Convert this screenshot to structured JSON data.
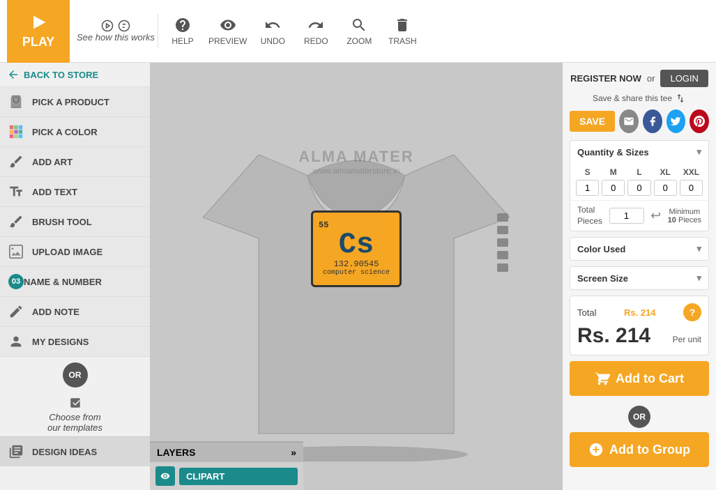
{
  "topbar": {
    "play_label": "PLAY",
    "how_it_works": "See how this works",
    "tools": [
      {
        "id": "help",
        "label": "HELP",
        "icon": "question-circle"
      },
      {
        "id": "preview",
        "label": "PREVIEW",
        "icon": "eye"
      },
      {
        "id": "undo",
        "label": "UNDO",
        "icon": "undo"
      },
      {
        "id": "redo",
        "label": "REDO",
        "icon": "redo"
      },
      {
        "id": "zoom",
        "label": "ZOOM",
        "icon": "search"
      },
      {
        "id": "trash",
        "label": "TRASH",
        "icon": "trash"
      }
    ]
  },
  "sidebar": {
    "back_label": "BACK TO STORE",
    "items": [
      {
        "id": "pick-product",
        "label": "PICK A PRODUCT",
        "icon": "tshirt"
      },
      {
        "id": "pick-color",
        "label": "PICK A COLOR",
        "icon": "grid"
      },
      {
        "id": "add-art",
        "label": "ADD ART",
        "icon": "brush"
      },
      {
        "id": "add-text",
        "label": "ADD TEXT",
        "icon": "T"
      },
      {
        "id": "brush-tool",
        "label": "BRUSH TOOL",
        "icon": "pencil"
      },
      {
        "id": "upload-image",
        "label": "UPLOAD IMAGE",
        "icon": "image"
      },
      {
        "id": "name-number",
        "label": "NAME & NUMBER",
        "icon": "03"
      },
      {
        "id": "add-note",
        "label": "ADD NOTE",
        "icon": "pencil2"
      },
      {
        "id": "my-designs",
        "label": "MY DESIGNS",
        "icon": "person"
      }
    ],
    "or_label": "OR",
    "choose_templates": "Choose from\nour templates",
    "design_ideas": "DESIGN IDEAS"
  },
  "canvas": {
    "watermark_brand": "ALMA MATER",
    "watermark_url": "www.almamaterstore.in",
    "clipart": {
      "number": "55",
      "symbol": "Cs",
      "mass": "132.90545",
      "name": "computer science"
    }
  },
  "layers": {
    "header": "LAYERS",
    "items": [
      {
        "id": "clipart",
        "label": "CLIPART",
        "visible": true
      }
    ]
  },
  "right_panel": {
    "register_label": "REGISTER NOW",
    "or_label": "or",
    "login_label": "LOGIN",
    "save_share_label": "Save & share this tee",
    "save_btn": "SAVE",
    "quantity_sizes": {
      "title": "Quantity & Sizes",
      "sizes": [
        "S",
        "M",
        "L",
        "XL",
        "XXL"
      ],
      "values": [
        "1",
        "0",
        "0",
        "0",
        "0"
      ],
      "total_label": "Total\nPieces",
      "total_value": "1",
      "min_label": "Minimum",
      "min_value": "10",
      "min_pieces": "Pieces"
    },
    "color_used": {
      "title": "Color Used"
    },
    "screen_size": {
      "title": "Screen Size"
    },
    "total_label": "Total",
    "total_amount": "Rs. 214",
    "price": "Rs. 214",
    "price_currency": "Rs.",
    "price_value": "214",
    "per_unit": "Per unit",
    "add_to_cart": "Add to Cart",
    "or_badge": "OR",
    "add_to_group": "Add to Group"
  }
}
